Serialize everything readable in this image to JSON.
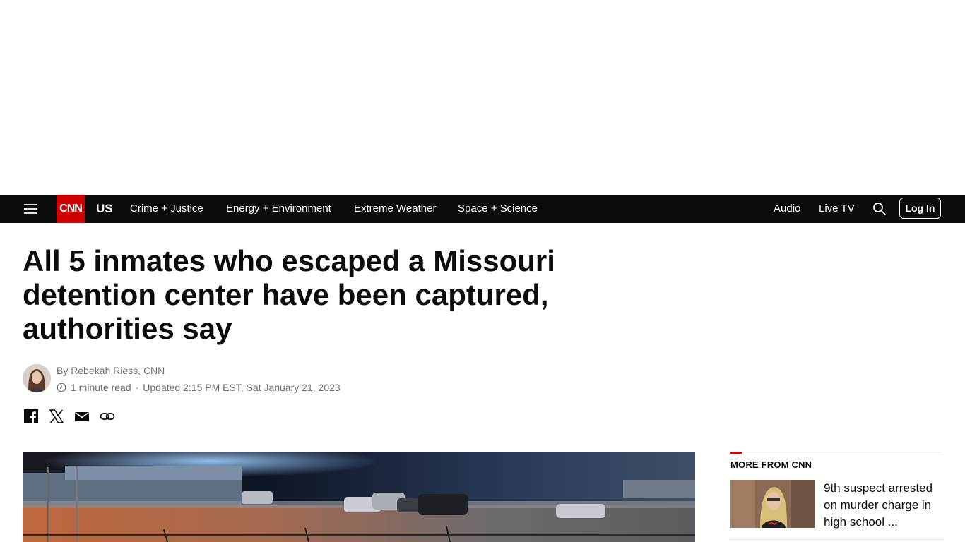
{
  "nav": {
    "brand": "CNN",
    "section": "US",
    "links": [
      "Crime + Justice",
      "Energy + Environment",
      "Extreme Weather",
      "Space + Science"
    ],
    "right_links": [
      "Audio",
      "Live TV"
    ],
    "login_label": "Log In",
    "icons": {
      "menu": "hamburger-menu-icon",
      "search": "search-icon"
    }
  },
  "article": {
    "headline": "All 5 inmates who escaped a Missouri detention center have been captured, authorities say",
    "byline_prefix": "By ",
    "author": "Rebekah Riess",
    "byline_suffix": ", CNN",
    "read_time": "1 minute read",
    "separator": "·",
    "updated": "Updated 2:15 PM EST, Sat January 21, 2023",
    "share_icons": [
      "facebook-icon",
      "x-icon",
      "email-icon",
      "link-icon"
    ]
  },
  "sidebar": {
    "title": "MORE FROM CNN",
    "items": [
      {
        "headline": "9th suspect arrested on murder charge in high school ..."
      }
    ]
  },
  "colors": {
    "brand_red": "#cc0000",
    "nav_bg": "#0c0c0c",
    "text": "#0c0c0c",
    "meta_text": "#6e6e6e"
  }
}
